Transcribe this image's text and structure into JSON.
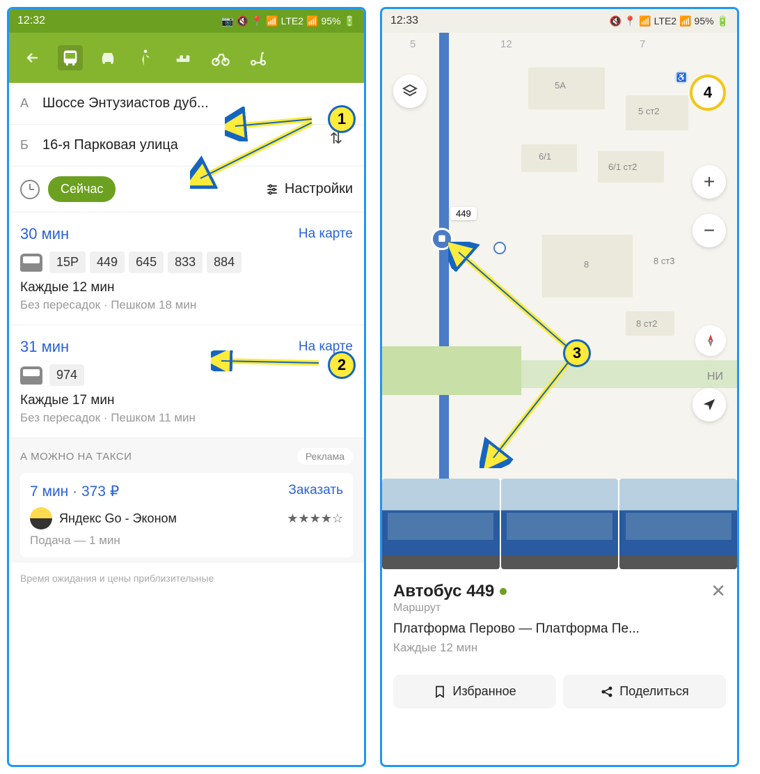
{
  "phone1": {
    "status": {
      "time": "12:32",
      "battery": "95%",
      "net": "LTE2"
    },
    "route": {
      "from_letter": "А",
      "from": "Шоссе Энтузиастов дуб...",
      "to_letter": "Б",
      "to": "16-я Парковая улица"
    },
    "now_label": "Сейчас",
    "settings_label": "Настройки",
    "options": [
      {
        "time": "30 мин",
        "map": "На карте",
        "buses": [
          "15Р",
          "449",
          "645",
          "833",
          "884"
        ],
        "freq": "Каждые 12 мин",
        "sub": "Без пересадок · Пешком 18 мин"
      },
      {
        "time": "31 мин",
        "map": "На карте",
        "buses": [
          "974"
        ],
        "freq": "Каждые 17 мин",
        "sub": "Без пересадок · Пешком 11 мин"
      }
    ],
    "taxi": {
      "header": "А МОЖНО НА ТАКСИ",
      "ad": "Реклама",
      "time_price": "7 мин · 373 ₽",
      "order": "Заказать",
      "service": "Яндекс Go - Эконом",
      "rating": "★★★★☆",
      "pickup": "Подача — 1 мин"
    },
    "disclaimer": "Время ожидания и цены приблизительные"
  },
  "phone2": {
    "status": {
      "time": "12:33",
      "battery": "95%",
      "net": "LTE2"
    },
    "map": {
      "top_nums": [
        "5",
        "12",
        "7"
      ],
      "labels": {
        "5a": "5А",
        "5ct2": "5 ст2",
        "61": "6/1",
        "61ct2": "6/1 ст2",
        "8": "8",
        "8ct3": "8 ст3",
        "8ct2": "8 ст2",
        "ni": "НИ"
      },
      "circle4": "4",
      "route_num": "449"
    },
    "bus_card": {
      "title": "Автобус 449",
      "subtitle": "Маршрут",
      "route": "Платформа Перово — Платформа Пе...",
      "freq": "Каждые 12 мин"
    },
    "actions": {
      "fav": "Избранное",
      "share": "Поделиться"
    }
  },
  "annotations": {
    "n1": "1",
    "n2": "2",
    "n3": "3"
  }
}
